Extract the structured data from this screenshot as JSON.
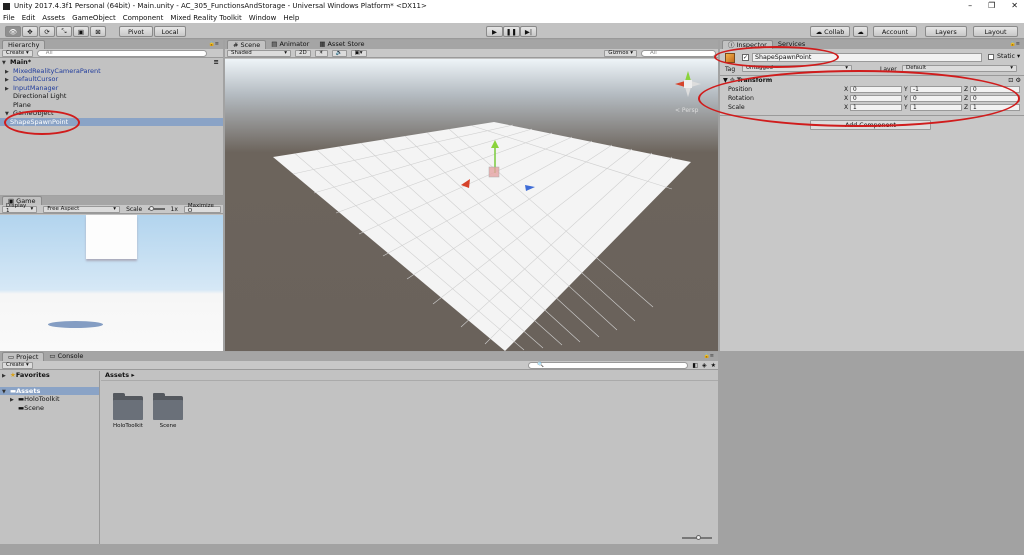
{
  "window": {
    "title": "Unity 2017.4.3f1 Personal (64bit) - Main.unity - AC_305_FunctionsAndStorage - Universal Windows Platform* <DX11>",
    "minimize": "–",
    "maximize": "❐",
    "close": "✕"
  },
  "menu": [
    "File",
    "Edit",
    "Assets",
    "GameObject",
    "Component",
    "Mixed Reality Toolkit",
    "Window",
    "Help"
  ],
  "toolbar": {
    "pivot": "Pivot",
    "local": "Local",
    "collab": "Collab",
    "account": "Account",
    "layers": "Layers",
    "layout": "Layout"
  },
  "hierarchy": {
    "tab": "Hierarchy",
    "create": "Create",
    "search_placeholder": "All",
    "scene": "Main*",
    "items": [
      {
        "label": "MixedRealityCameraParent"
      },
      {
        "label": "DefaultCursor"
      },
      {
        "label": "InputManager"
      },
      {
        "label": "Directional Light"
      },
      {
        "label": "Plane"
      },
      {
        "label": "GameObject"
      },
      {
        "label": "ShapeSpawnPoint"
      }
    ]
  },
  "game": {
    "tab": "Game",
    "display": "Display 1",
    "aspect": "Free Aspect",
    "scale_label": "Scale",
    "scale_value": "1x",
    "maximize": "Maximize O"
  },
  "scene_view": {
    "tabs": [
      "Scene",
      "Animator",
      "Asset Store"
    ],
    "shading": "Shaded",
    "mode2d": "2D",
    "gizmos": "Gizmos",
    "search_placeholder": "All",
    "persp": "< Persp"
  },
  "inspector": {
    "tabs": [
      "Inspector",
      "Services"
    ],
    "object_name": "ShapeSpawnPoint",
    "static": "Static",
    "tag_label": "Tag",
    "tag_value": "Untagged",
    "layer_label": "Layer",
    "layer_value": "Default",
    "component": "Transform",
    "position": {
      "label": "Position",
      "x": "0",
      "y": "-1",
      "z": "0"
    },
    "rotation": {
      "label": "Rotation",
      "x": "0",
      "y": "0",
      "z": "0"
    },
    "scale": {
      "label": "Scale",
      "x": "1",
      "y": "1",
      "z": "1"
    },
    "axes": [
      "X",
      "Y",
      "Z"
    ],
    "add_component": "Add Component"
  },
  "project": {
    "tabs": [
      "Project",
      "Console"
    ],
    "create": "Create",
    "favorites": "Favorites",
    "assets_root": "Assets",
    "tree": [
      "HoloToolkit",
      "Scene"
    ],
    "breadcrumb": "Assets",
    "folders": [
      "HoloToolkit",
      "Scene"
    ]
  },
  "colors": {
    "annotation": "#d01c1c",
    "selection": "#8aa3c6",
    "prefab": "#1f3b9c"
  }
}
